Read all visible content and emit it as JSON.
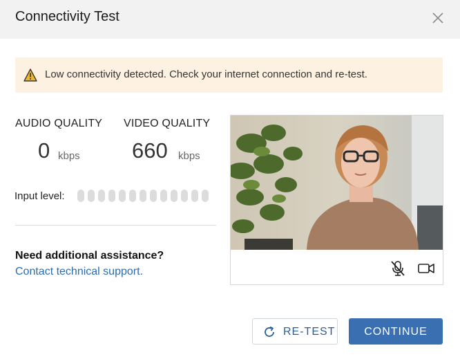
{
  "dialog": {
    "title": "Connectivity Test"
  },
  "alert": {
    "message": "Low connectivity detected. Check your internet connection and re-test.",
    "icon": "warning-icon",
    "bg_color": "#fdf2e1"
  },
  "audio": {
    "label": "AUDIO QUALITY",
    "value": "0",
    "unit": "kbps"
  },
  "video": {
    "label": "VIDEO QUALITY",
    "value": "660",
    "unit": "kbps"
  },
  "input_level": {
    "label": "Input level:",
    "total_segments": 13,
    "active_segments": 0
  },
  "assist": {
    "title": "Need additional assistance?",
    "link": "Contact technical support."
  },
  "video_controls": {
    "mic_icon": "mic-muted-icon",
    "camera_icon": "video-camera-icon"
  },
  "buttons": {
    "retest": "RE-TEST",
    "continue": "CONTINUE",
    "primary_color": "#3a6fb2"
  }
}
